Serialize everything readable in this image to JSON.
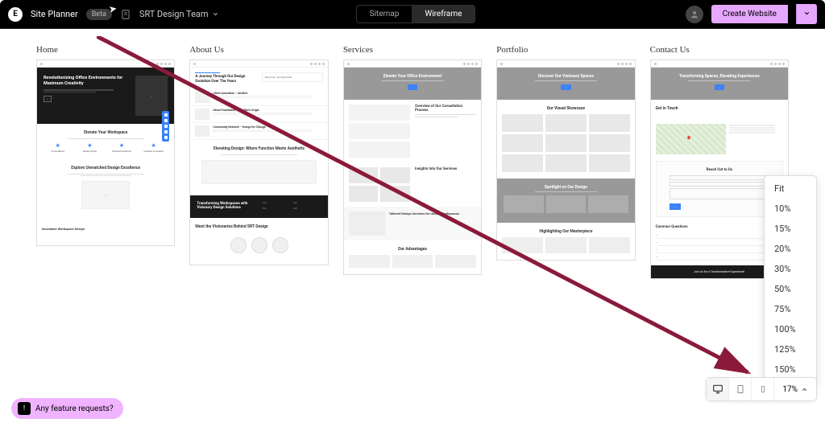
{
  "header": {
    "app_name": "Site Planner",
    "badge": "Beta",
    "team_name": "SRT Design Team",
    "tabs": {
      "sitemap": "Sitemap",
      "wireframe": "Wireframe"
    },
    "create_button": "Create Website"
  },
  "columns": {
    "home": {
      "title": "Home",
      "hero_title": "Revolutionizing Office Environments for Maximum Creativity",
      "sec1_title": "Elevate Your Workspace",
      "features": [
        "Consultation",
        "Design Plans",
        "Tailored Solutions",
        "Creative Concepts"
      ],
      "sec2_title": "Explore Unmatched Design Excellence",
      "sec3_title": "Innovative Workspace Design"
    },
    "about": {
      "title": "About Us",
      "hero_title": "A Journey Through Our Design Evolution Over The Years",
      "items": [
        "About Our Journey's Past",
        "Client Innovation – Another",
        "About Foundation – Another's Origin",
        "Community Network – Design for Change"
      ],
      "sec2_title": "Elevating Design: Where Function Meets Aesthetic",
      "dark_title": "Transforming Workspaces with Visionary Design Solutions",
      "sec3_title": "Meet the Visionaries Behind SRT Design"
    },
    "services": {
      "title": "Services",
      "hero_title": "Elevate Your Office Environment",
      "sec1_title": "Overview of Our Consultation Process",
      "sec2_title": "Insights Into Our Services",
      "sec3_title": "Tailored Design Services for Unique Workspaces",
      "sec4_title": "Our Advantages"
    },
    "portfolio": {
      "title": "Portfolio",
      "hero_title": "Discover Our Visionary Spaces",
      "sec1_title": "Our Visual Showcase",
      "sec2_title": "Spotlight on Our Design",
      "sec3_title": "Highlighting Our Masterpiece"
    },
    "contact": {
      "title": "Contact Us",
      "hero_title": "Transforming Spaces, Elevating Experiences",
      "sec1_title": "Get in Touch",
      "sec2_title": "Reach Out to Us",
      "sec3_title": "Common Questions",
      "cta": "Join Us for a Transformative Experience!"
    }
  },
  "zoom_menu": [
    "Fit",
    "10%",
    "15%",
    "20%",
    "30%",
    "50%",
    "75%",
    "100%",
    "125%",
    "150%"
  ],
  "zoom_current": "17%",
  "feedback_label": "Any feature requests?"
}
